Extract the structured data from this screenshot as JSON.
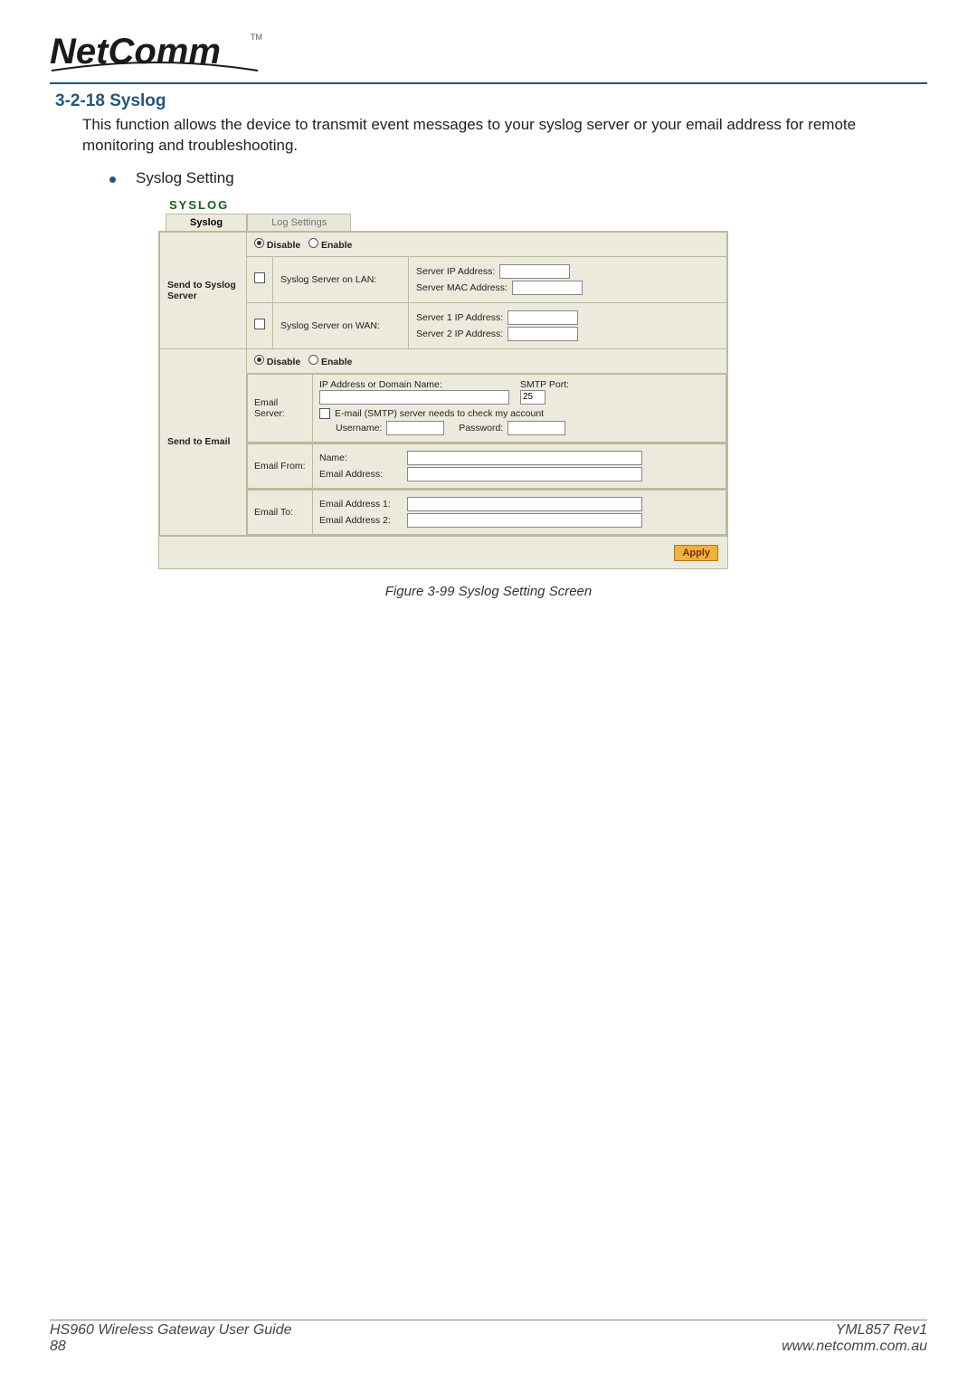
{
  "logo_tm": "TM",
  "section_heading": "3-2-18 Syslog",
  "intro_text": "This function allows the device to transmit event messages to your syslog server or your email address for remote monitoring and troubleshooting.",
  "bullet_label": "Syslog Setting",
  "screen": {
    "title": "SYSLOG",
    "tabs": {
      "syslog": "Syslog",
      "log_settings": "Log Settings"
    },
    "radio_disable": "Disable",
    "radio_enable": "Enable",
    "send_to_syslog": "Send to Syslog Server",
    "lan_label": "Syslog Server on LAN:",
    "lan_ip": "Server IP Address:",
    "lan_mac": "Server MAC Address:",
    "wan_label": "Syslog Server on WAN:",
    "wan_ip1": "Server 1 IP Address:",
    "wan_ip2": "Server 2 IP Address:",
    "send_to_email": "Send to Email",
    "email_server": "Email Server:",
    "ip_or_domain": "IP Address or Domain Name:",
    "smtp_port": "SMTP Port:",
    "smtp_port_value": "25",
    "smtp_check": "E-mail (SMTP) server needs to check my account",
    "username": "Username:",
    "password": "Password:",
    "email_from": "Email From:",
    "name": "Name:",
    "email_addr": "Email Address:",
    "email_to": "Email To:",
    "email_addr1": "Email Address 1:",
    "email_addr2": "Email Address 2:",
    "apply": "Apply"
  },
  "figure_caption": "Figure 3-99 Syslog Setting Screen",
  "footer": {
    "guide": "HS960 Wireless Gateway User Guide",
    "rev": "YML857 Rev1",
    "page": "88",
    "url": "www.netcomm.com.au"
  }
}
